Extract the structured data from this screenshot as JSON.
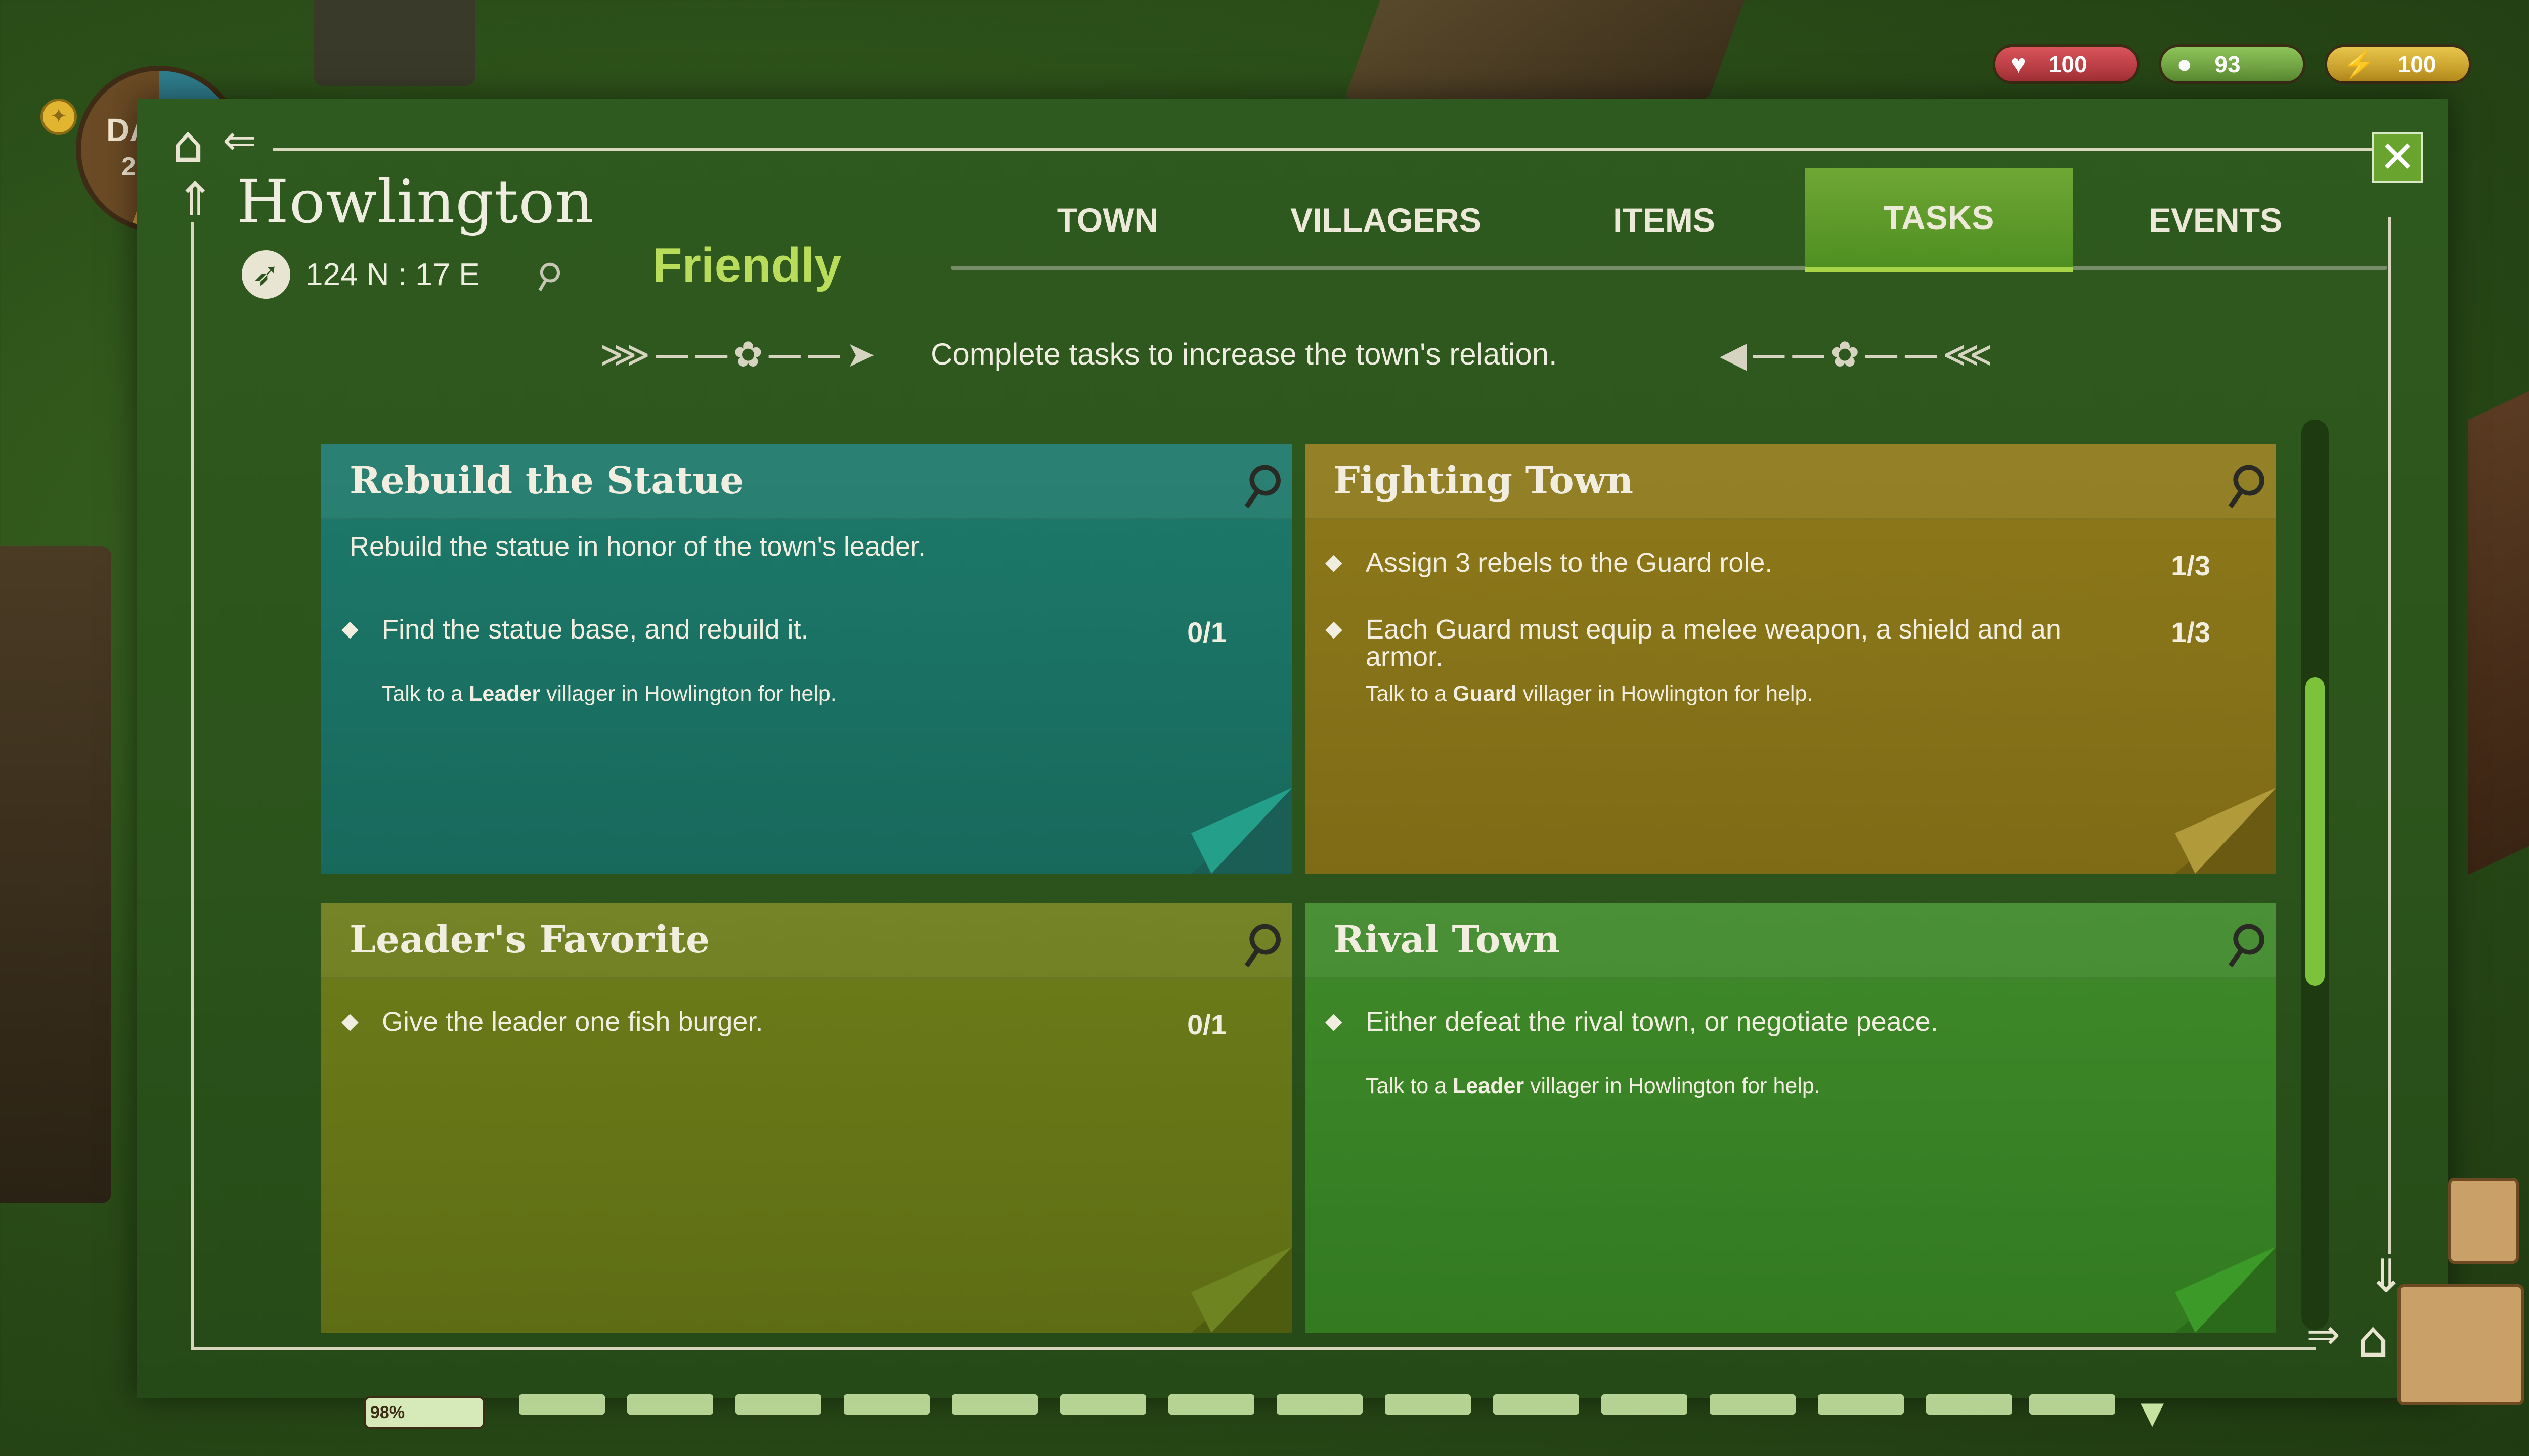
{
  "hud": {
    "day_label": "DA",
    "day_number": "2",
    "health": "100",
    "food": "93",
    "energy": "100"
  },
  "town": {
    "name": "Howlington",
    "coordinates": "124 N : 17 E",
    "relation": "Friendly"
  },
  "tabs": [
    {
      "label": "TOWN"
    },
    {
      "label": "VILLAGERS"
    },
    {
      "label": "ITEMS"
    },
    {
      "label": "TASKS"
    },
    {
      "label": "EVENTS"
    }
  ],
  "active_tab": "TASKS",
  "subtitle": "Complete tasks to increase the town's relation.",
  "tasks": [
    {
      "title": "Rebuild the Statue",
      "description": "Rebuild the statue in honor of the town's leader.",
      "objectives": [
        {
          "text": "Find the statue base, and rebuild it.",
          "progress": "0/1"
        }
      ],
      "hint_prefix": "Talk to a ",
      "hint_role": "Leader",
      "hint_suffix": " villager in Howlington for help."
    },
    {
      "title": "Fighting Town",
      "description": "",
      "objectives": [
        {
          "text": "Assign 3 rebels to the Guard role.",
          "progress": "1/3"
        },
        {
          "text": "Each Guard must equip a melee weapon, a shield and an armor.",
          "progress": "1/3"
        }
      ],
      "hint_prefix": "Talk to a ",
      "hint_role": "Guard",
      "hint_suffix": " villager in Howlington for help."
    },
    {
      "title": "Leader's Favorite",
      "description": "",
      "objectives": [
        {
          "text": "Give the leader one fish burger.",
          "progress": "0/1"
        }
      ]
    },
    {
      "title": "Rival Town",
      "description": "",
      "objectives": [
        {
          "text": "Either defeat the rival town, or negotiate peace.",
          "progress": ""
        }
      ],
      "hint_prefix": "Talk to a ",
      "hint_role": "Leader",
      "hint_suffix": " villager in Howlington for help."
    }
  ],
  "hotbar": {
    "progress_label": "98%",
    "progress_value": 0.98
  },
  "icons": {
    "health": "heart-icon",
    "food": "apple-icon",
    "energy": "lightning-icon",
    "close": "close-icon",
    "compass": "compass-icon",
    "pin": "pin-icon"
  },
  "colors": {
    "panel": "#2b531b",
    "active_tab": "#5f9e2b",
    "relation": "#b9dc5a",
    "card_teal": "#1d7a6b",
    "card_gold": "#8e7a1a",
    "card_olive": "#6d7d19",
    "card_green": "#3f8a2a",
    "scroll_thumb": "#7cc23a"
  }
}
